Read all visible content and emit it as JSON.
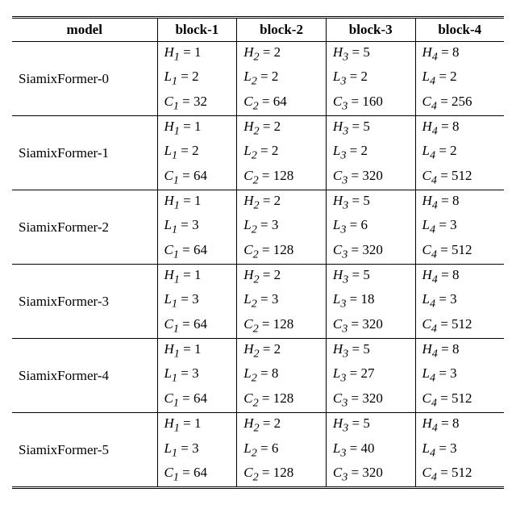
{
  "chart_data": {
    "type": "table",
    "title": "",
    "columns": [
      "model",
      "block-1",
      "block-2",
      "block-3",
      "block-4"
    ],
    "rows": [
      {
        "model": "SiamixFormer-0",
        "H": [
          1,
          2,
          5,
          8
        ],
        "L": [
          2,
          2,
          2,
          2
        ],
        "C": [
          32,
          64,
          160,
          256
        ]
      },
      {
        "model": "SiamixFormer-1",
        "H": [
          1,
          2,
          5,
          8
        ],
        "L": [
          2,
          2,
          2,
          2
        ],
        "C": [
          64,
          128,
          320,
          512
        ]
      },
      {
        "model": "SiamixFormer-2",
        "H": [
          1,
          2,
          5,
          8
        ],
        "L": [
          3,
          3,
          6,
          3
        ],
        "C": [
          64,
          128,
          320,
          512
        ]
      },
      {
        "model": "SiamixFormer-3",
        "H": [
          1,
          2,
          5,
          8
        ],
        "L": [
          3,
          3,
          18,
          3
        ],
        "C": [
          64,
          128,
          320,
          512
        ]
      },
      {
        "model": "SiamixFormer-4",
        "H": [
          1,
          2,
          5,
          8
        ],
        "L": [
          3,
          8,
          27,
          3
        ],
        "C": [
          64,
          128,
          320,
          512
        ]
      },
      {
        "model": "SiamixFormer-5",
        "H": [
          1,
          2,
          5,
          8
        ],
        "L": [
          3,
          6,
          40,
          3
        ],
        "C": [
          64,
          128,
          320,
          512
        ]
      }
    ]
  },
  "headers": {
    "model": "model",
    "b1": "block-1",
    "b2": "block-2",
    "b3": "block-3",
    "b4": "block-4"
  },
  "rows": [
    {
      "model": "SiamixFormer-0",
      "blocks": [
        {
          "H": "1",
          "L": "2",
          "C": "32"
        },
        {
          "H": "2",
          "L": "2",
          "C": "64"
        },
        {
          "H": "5",
          "L": "2",
          "C": "160"
        },
        {
          "H": "8",
          "L": "2",
          "C": "256"
        }
      ]
    },
    {
      "model": "SiamixFormer-1",
      "blocks": [
        {
          "H": "1",
          "L": "2",
          "C": "64"
        },
        {
          "H": "2",
          "L": "2",
          "C": "128"
        },
        {
          "H": "5",
          "L": "2",
          "C": "320"
        },
        {
          "H": "8",
          "L": "2",
          "C": "512"
        }
      ]
    },
    {
      "model": "SiamixFormer-2",
      "blocks": [
        {
          "H": "1",
          "L": "3",
          "C": "64"
        },
        {
          "H": "2",
          "L": "3",
          "C": "128"
        },
        {
          "H": "5",
          "L": "6",
          "C": "320"
        },
        {
          "H": "8",
          "L": "3",
          "C": "512"
        }
      ]
    },
    {
      "model": "SiamixFormer-3",
      "blocks": [
        {
          "H": "1",
          "L": "3",
          "C": "64"
        },
        {
          "H": "2",
          "L": "3",
          "C": "128"
        },
        {
          "H": "5",
          "L": "18",
          "C": "320"
        },
        {
          "H": "8",
          "L": "3",
          "C": "512"
        }
      ]
    },
    {
      "model": "SiamixFormer-4",
      "blocks": [
        {
          "H": "1",
          "L": "3",
          "C": "64"
        },
        {
          "H": "2",
          "L": "8",
          "C": "128"
        },
        {
          "H": "5",
          "L": "27",
          "C": "320"
        },
        {
          "H": "8",
          "L": "3",
          "C": "512"
        }
      ]
    },
    {
      "model": "SiamixFormer-5",
      "blocks": [
        {
          "H": "1",
          "L": "3",
          "C": "64"
        },
        {
          "H": "2",
          "L": "6",
          "C": "128"
        },
        {
          "H": "5",
          "L": "40",
          "C": "320"
        },
        {
          "H": "8",
          "L": "3",
          "C": "512"
        }
      ]
    }
  ]
}
